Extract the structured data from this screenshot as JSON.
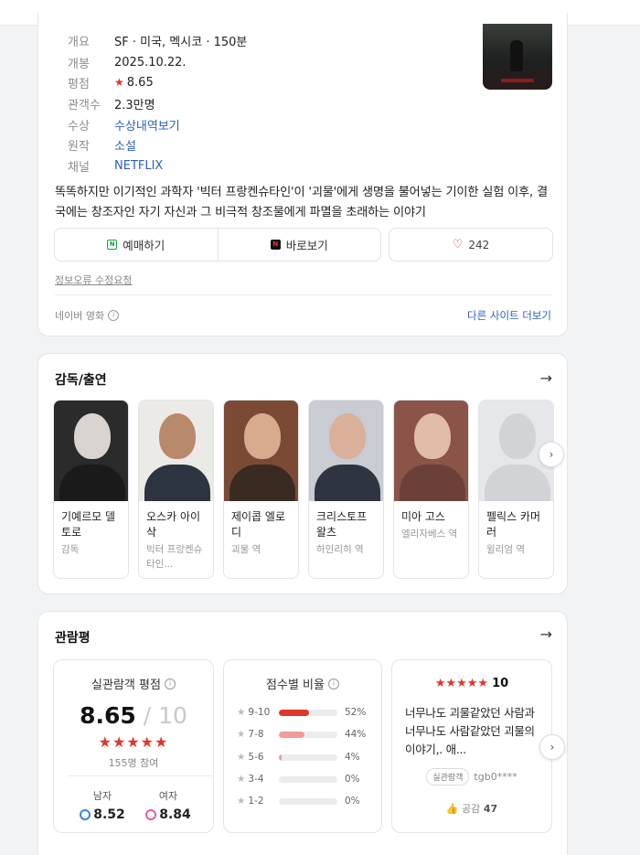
{
  "movie": {
    "info": [
      {
        "key": "개요",
        "value": "SF · 미국, 멕시코 · 150분",
        "link": false
      },
      {
        "key": "개봉",
        "value": "2025.10.22.",
        "link": false
      },
      {
        "key": "평점",
        "value": "8.65",
        "link": false,
        "star": "★"
      },
      {
        "key": "관객수",
        "value": "2.3만명",
        "link": false
      },
      {
        "key": "수상",
        "value": "수상내역보기",
        "link": true
      },
      {
        "key": "원작",
        "value": "소설",
        "link": true
      },
      {
        "key": "채널",
        "value": "NETFLIX",
        "link": true
      }
    ],
    "description": "똑똑하지만 이기적인 과학자 '빅터 프랑켄슈타인'이 '괴물'에게 생명을 불어넣는 기이한 실험 이후, 결국에는 창조자인 자기 자신과 그 비극적 창조물에게 파멸을 초래하는 이야기",
    "buttons": {
      "reserve": "예매하기",
      "reserve_icon": "N",
      "watch": "바로보기",
      "watch_icon": "N",
      "like_count": "242"
    },
    "error_report": "정보오류 수정요청",
    "source": "네이버 영화",
    "other_sites": "다른 사이트 더보기"
  },
  "cast": {
    "title": "감독/출연",
    "people": [
      {
        "name": "기예르모 델 토로",
        "role": "감독",
        "bg": "#2b2b2b",
        "skin": "#d9d4cf",
        "cloth": "#1a1a1a"
      },
      {
        "name": "오스카 아이삭",
        "role": "빅터 프랑켄슈타인...",
        "bg": "#eceae6",
        "skin": "#b98a6a",
        "cloth": "#2c3440"
      },
      {
        "name": "제이콥 엘로디",
        "role": "괴물 역",
        "bg": "#7a4a35",
        "skin": "#d8ab8f",
        "cloth": "#3a2b22"
      },
      {
        "name": "크리스토프 왈츠",
        "role": "하인리히 역",
        "bg": "#c9ccd3",
        "skin": "#d9b19a",
        "cloth": "#2f3540"
      },
      {
        "name": "미아 고스",
        "role": "엘리자베스 역",
        "bg": "#8a5448",
        "skin": "#e1bca6",
        "cloth": "#6b4038"
      },
      {
        "name": "펠릭스 카머러",
        "role": "윌리엄 역",
        "bg": "#e6e7ea",
        "skin": "#d1d3d7",
        "cloth": "#d1d3d7"
      }
    ]
  },
  "reviews": {
    "title": "관람평",
    "rating_title": "실관람객 평점",
    "score": "8.65",
    "score_sep": " / 10",
    "stars": "★★★★★",
    "participants": "155명 참여",
    "male_label": "남자",
    "male_score": "8.52",
    "female_label": "여자",
    "female_score": "8.84",
    "dist_title": "점수별 비율",
    "distribution": [
      {
        "label": "9-10",
        "pct": "52%",
        "value": 52,
        "color": "#e2352c"
      },
      {
        "label": "7-8",
        "pct": "44%",
        "value": 44,
        "color": "#f19b9b"
      },
      {
        "label": "5-6",
        "pct": "4%",
        "value": 4,
        "color": "#f19b9b"
      },
      {
        "label": "3-4",
        "pct": "0%",
        "value": 0,
        "color": "#f19b9b"
      },
      {
        "label": "1-2",
        "pct": "0%",
        "value": 0,
        "color": "#f19b9b"
      }
    ],
    "review": {
      "stars": "★★★★★",
      "score": "10",
      "text": "너무나도 괴물같았던 사람과너무나도 사람같았던 괴물의 이야기,. 애...",
      "badge": "실관람객",
      "user": "tgb0****",
      "likes_label": "공감",
      "likes": "47"
    }
  }
}
